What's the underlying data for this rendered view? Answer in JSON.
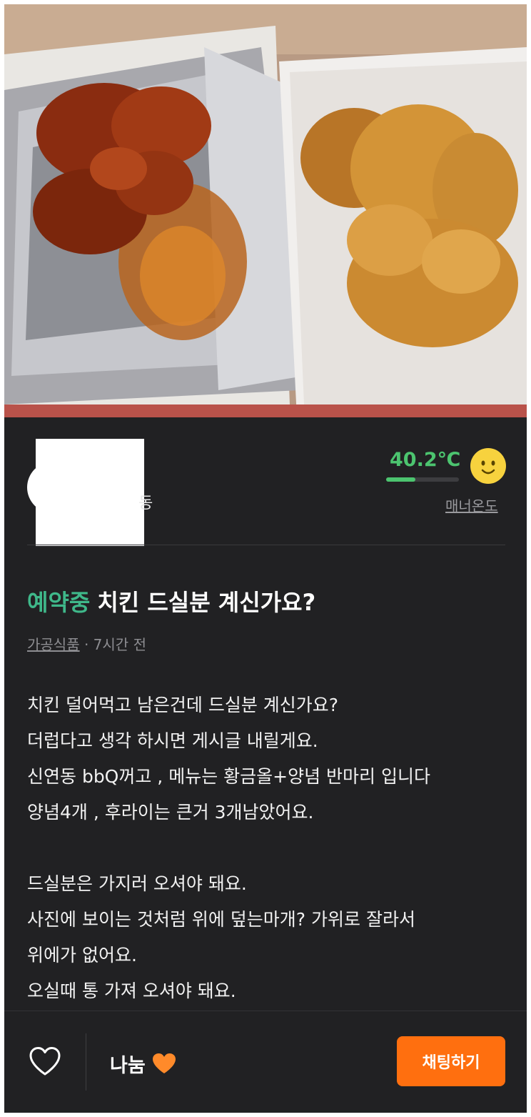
{
  "profile": {
    "region_fragment": "동",
    "manner_temp": "40.2℃",
    "manner_temp_value": 40.2,
    "manner_label": "매너온도",
    "temp_color": "#4cc46f",
    "face_icon": "smiling-face-icon"
  },
  "post": {
    "status": "예약중",
    "status_color": "#3fb88a",
    "title": "치킨 드실분 계신가요?",
    "category": "가공식품",
    "time": " · 7시간 전",
    "body": [
      "치킨 덜어먹고 남은건데 드실분 계신가요?",
      "더럽다고 생각 하시면 게시글 내릴게요.",
      "신연동 bbQ꺼고 , 메뉴는 황금올+양념 반마리 입니다",
      "양념4개 , 후라이는 큰거 3개남았어요.",
      "",
      "드실분은 가지러 오셔야 돼요.",
      "사진에 보이는 것처럼 위에 덮는마개? 가위로 잘라서",
      "위에가 없어요.",
      "오실때 통 가져 오셔야 돼요."
    ]
  },
  "bottom_bar": {
    "like_icon": "heart-outline-icon",
    "share_label": "나눔",
    "share_icon": "orange-heart-icon",
    "chat_button": "채팅하기",
    "accent": "#ff6f0f"
  }
}
